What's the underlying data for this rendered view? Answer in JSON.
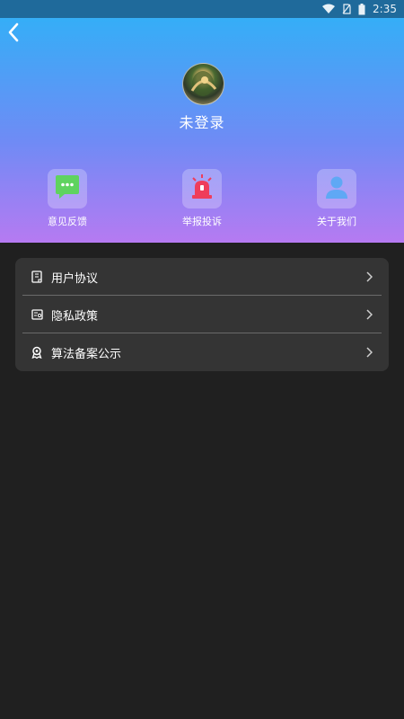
{
  "status_bar": {
    "time": "2:35",
    "icons": [
      "wifi-icon",
      "no-sim-icon",
      "battery-icon"
    ]
  },
  "header": {
    "back_icon": "chevron-left-icon",
    "user_label": "未登录",
    "gradient": [
      "#35aef7",
      "#6f8bf5",
      "#b67af2"
    ]
  },
  "quick_actions": [
    {
      "label": "意见反馈",
      "icon": "chat-bubble-icon",
      "color": "#5fd35f"
    },
    {
      "label": "举报投诉",
      "icon": "alarm-light-icon",
      "color": "#ef3d5b"
    },
    {
      "label": "关于我们",
      "icon": "user-icon",
      "color": "#5fa8f5"
    }
  ],
  "menu": [
    {
      "label": "用户协议",
      "icon": "document-icon"
    },
    {
      "label": "隐私政策",
      "icon": "privacy-card-icon"
    },
    {
      "label": "算法备案公示",
      "icon": "ribbon-badge-icon"
    }
  ]
}
